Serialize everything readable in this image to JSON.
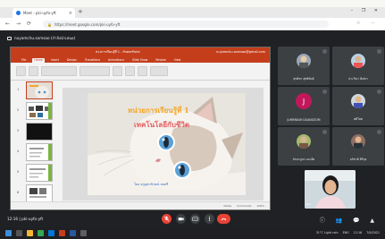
{
  "browser": {
    "tab_title": "Meet - pki-uyfo-yft",
    "tab_close": "×",
    "new_tab": "+",
    "window_controls": "–  ❐  ✕",
    "nav": {
      "back": "←",
      "forward": "→",
      "reload": "⟳"
    },
    "url": "https://meet.google.com/pki-uyfo-yft",
    "lock_icon": "🔒",
    "tools": "☆ ⋯"
  },
  "meet": {
    "presenting_label": "nuyamchu.somsao (กำลังนำเสนอ)",
    "meeting_code": "pki-uyfo-yft",
    "clock": "12:16",
    "right_controls": "ⓘ 👥 💬 ▲",
    "colors": {
      "bg": "#202124",
      "tile": "#3c4043",
      "end_call": "#ea4335"
    },
    "participants": [
      {
        "name": "สุทธิชา สุทธิพันธ์",
        "avatar": "photo"
      },
      {
        "name": "ประวีณา ดีเสถร",
        "avatar": "photo"
      },
      {
        "name": "JUMRRASH DUANGSOM",
        "avatar": "J"
      },
      {
        "name": "ศศิโสด",
        "avatar": "photo"
      },
      {
        "name": "รัตนาภูมร เตะเตีย",
        "avatar": "photo"
      },
      {
        "name": "อภิชาติ ศิริกุล",
        "avatar": "photo"
      }
    ],
    "self_view_label": "คุณ"
  },
  "powerpoint": {
    "file_title": "ห่วงการเรียนรู้ที่ 1 - PowerPoint",
    "user": "nuyamchu.somsao@gmail.com",
    "menu": [
      "File",
      "Home",
      "Insert",
      "Design",
      "Transitions",
      "Animations",
      "Slide Show",
      "Review",
      "View"
    ],
    "active_menu_index": 1,
    "slide_numbers": [
      "1",
      "2",
      "3",
      "4",
      "5",
      "6"
    ],
    "status": [
      "Notes",
      "Comments",
      "100%"
    ],
    "colors": {
      "accent": "#c43e1c"
    }
  },
  "slide": {
    "title_line1": "หน่วยการเรียนรู้ที่ 1",
    "title_line2": "เทคโนโลยีกับชีวิต",
    "author": "โดย ครูยุพาลักษณ์ สมศรี"
  },
  "taskbar": {
    "weather": "31°C Light rain",
    "language": "ENG",
    "time": "12:16",
    "date": "7/9/2021"
  }
}
